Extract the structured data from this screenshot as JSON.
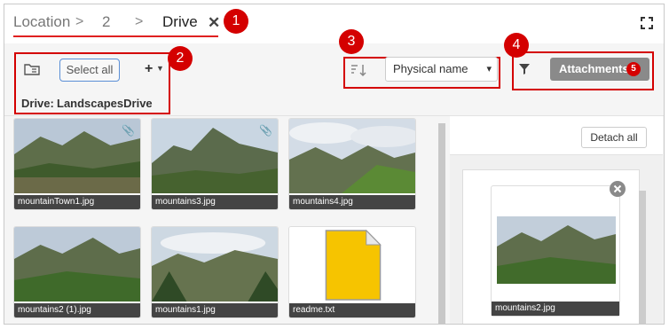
{
  "breadcrumb": {
    "items": [
      "Location",
      "2",
      "Drive"
    ],
    "separator": ">",
    "close": "✕"
  },
  "callouts": [
    "1",
    "2",
    "3",
    "4",
    "5"
  ],
  "toolbar": {
    "select_all": "Select all",
    "add": "+",
    "drive_label": "Drive:",
    "drive_value": "LandscapesDrive",
    "sort_value": "Physical name",
    "attachments_label": "Attachments",
    "attachments_count": "5"
  },
  "files": [
    {
      "name": "mountainTown1.jpg",
      "attached": true
    },
    {
      "name": "mountains3.jpg",
      "attached": true
    },
    {
      "name": "mountains4.jpg",
      "attached": false
    },
    {
      "name": "mountains2 (1).jpg",
      "attached": false
    },
    {
      "name": "mountains1.jpg",
      "attached": false
    },
    {
      "name": "readme.txt",
      "attached": false
    }
  ],
  "panel": {
    "detach_all": "Detach all",
    "attachment_name": "mountains2.jpg"
  },
  "colors": {
    "callout": "#d40000",
    "accent": "#5b8fd6",
    "caption_bg": "#444444"
  }
}
